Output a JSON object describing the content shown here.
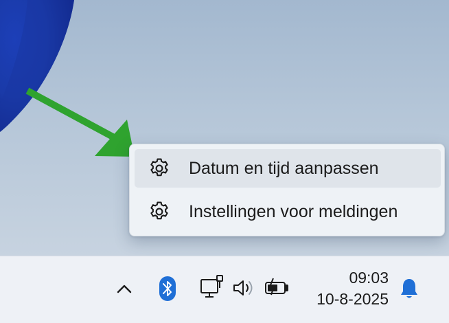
{
  "context_menu": {
    "items": [
      {
        "label": "Datum en tijd aanpassen",
        "icon": "gear-icon",
        "highlighted": true
      },
      {
        "label": "Instellingen voor meldingen",
        "icon": "gear-icon",
        "highlighted": false
      }
    ]
  },
  "taskbar": {
    "tray_icons": [
      "chevron-up-icon",
      "bluetooth-icon",
      "network-icon",
      "volume-icon",
      "battery-icon"
    ],
    "clock": {
      "time": "09:03",
      "date": "10-8-2025"
    },
    "notification_icon": "bell-icon"
  },
  "colors": {
    "arrow": "#2fa32f",
    "bluetooth": "#1f6fd6",
    "bell": "#1f6fd6",
    "menu_background": "#eef2f6",
    "menu_highlight": "#dfe4ea",
    "taskbar_background": "#eef1f6"
  }
}
